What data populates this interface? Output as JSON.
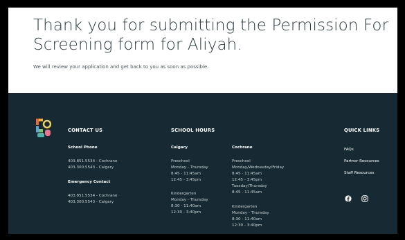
{
  "hero": {
    "title": "Thank you for submitting the Permission For Screening form for Aliyah.",
    "subtitle": "We will review your application and get back to you as soon as possible."
  },
  "footer": {
    "contact": {
      "heading": "CONTACT US",
      "school_phone_label": "School Phone",
      "school_phone_cochrane": "403.851.5534 - Cochrane",
      "school_phone_calgary": "403.300.5543 - Calgary",
      "emergency_label": "Emergency Contact",
      "emergency_cochrane": "403.851.5534 - Cochrane",
      "emergency_calgary": "403.300.5543 - Calgary"
    },
    "hours": {
      "heading": "SCHOOL HOURS",
      "calgary": {
        "label": "Calgary",
        "preschool": "Preschool",
        "preschool_days": "Monday - Thursday",
        "preschool_am": "8:45 - 11:45am",
        "preschool_pm": "12:45 - 3:45pm",
        "kinder": "Kindergarten",
        "kinder_days": "Monday - Thursday",
        "kinder_am": "8:30 - 11:40am",
        "kinder_pm": "12:30 - 3:40pm"
      },
      "cochrane": {
        "label": "Cochrane",
        "preschool": "Preschool",
        "preschool_days": "Monday/Wednesday/Friday",
        "preschool_am": "8:45 - 11:45am",
        "preschool_pm": "12:45 - 3:45pm",
        "preschool_days2": "Tuesday/Thursday",
        "preschool_am2": "8:45 - 11:45am",
        "kinder": "Kindergarten",
        "kinder_days": "Monday - Thursday",
        "kinder_am": "8:30 - 11:40am",
        "kinder_pm": "12:30 - 3:40pm"
      }
    },
    "quick_links": {
      "heading": "QUICK LINKS",
      "faqs": "FAQs",
      "partner": "Partner Resources",
      "staff": "Staff Resources"
    },
    "social": [
      "facebook-icon",
      "instagram-icon"
    ]
  },
  "colors": {
    "footer_bg": "#172a33",
    "title_text": "#2b3a3e"
  }
}
